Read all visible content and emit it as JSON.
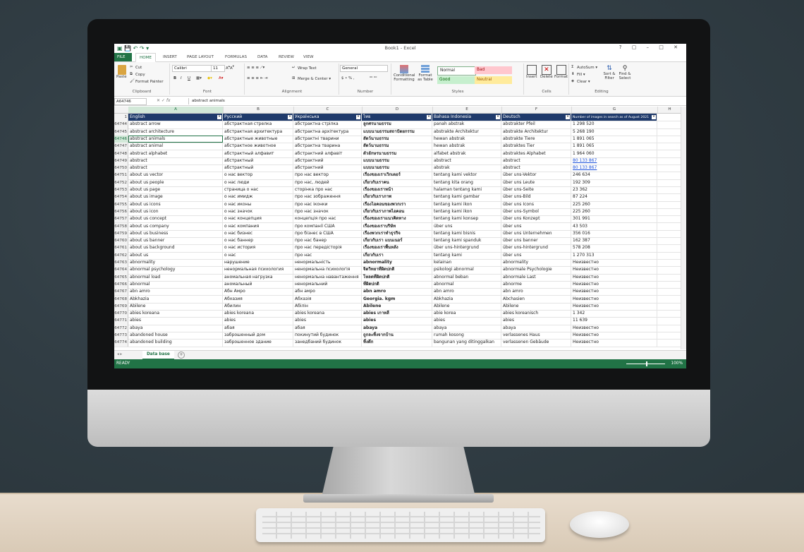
{
  "window": {
    "title": "Book1 - Excel",
    "controls": "? ▢ – □ ✕"
  },
  "ribbon_tabs": [
    "FILE",
    "HOME",
    "INSERT",
    "PAGE LAYOUT",
    "FORMULAS",
    "DATA",
    "REVIEW",
    "VIEW"
  ],
  "active_tab": "HOME",
  "ribbon": {
    "clipboard": {
      "label": "Clipboard",
      "paste": "Paste",
      "cut": "Cut",
      "copy": "Copy",
      "painter": "Format Painter"
    },
    "font": {
      "label": "Font",
      "name": "Calibri",
      "size": "11"
    },
    "alignment": {
      "label": "Alignment",
      "wrap": "Wrap Text",
      "merge": "Merge & Center"
    },
    "number": {
      "label": "Number",
      "format": "General",
      "symbols": "$ • % ,",
      "decimals": "⁰⁰ ⁰⁰"
    },
    "styles": {
      "label": "Styles",
      "conditional": "Conditional Formatting",
      "format_table": "Format as Table",
      "normal": "Normal",
      "bad": "Bad",
      "good": "Good",
      "neutral": "Neutral"
    },
    "cells": {
      "label": "Cells",
      "insert": "Insert",
      "delete": "Delete",
      "format": "Format"
    },
    "editing": {
      "label": "Editing",
      "autosum": "AutoSum",
      "fill": "Fill",
      "clear": "Clear",
      "sort": "Sort & Filter",
      "find": "Find & Select"
    }
  },
  "formula_bar": {
    "name_box": "A64746",
    "fx": "fx",
    "value": "abstract animals"
  },
  "columns": [
    "A",
    "B",
    "C",
    "D",
    "E",
    "F",
    "G",
    "H"
  ],
  "header_row": {
    "row": "1",
    "cells": [
      "English",
      "Русский",
      "Українська",
      "ไทย",
      "Bahasa Indonesia",
      "Deutsch",
      "Number of images in search as of August 2021"
    ]
  },
  "rows": [
    {
      "n": "64744",
      "c": [
        "abstract arrow",
        "абстрактная стрелка",
        "абстрактна стрілка",
        "ลูกศรนามธรรม",
        "panah abstrak",
        "abstrakter Pfeil",
        "1 298 520"
      ]
    },
    {
      "n": "64745",
      "c": [
        "abstract architecture",
        "абстрактная архитектура",
        "абстрактна архітектура",
        "แบบนามธรรมสถาปัตยกรรม",
        "abstrakte Architektur",
        "abstrakte Architektur",
        "5 268 190"
      ]
    },
    {
      "n": "64746",
      "c": [
        "abstract animals",
        "абстрактные животные",
        "абстрактні тварини",
        "สัตว์นามธรรม",
        "hewan abstrak",
        "abstrakte Tiere",
        "1 891 065"
      ]
    },
    {
      "n": "64747",
      "c": [
        "abstract animal",
        "абстрактное животное",
        "абстрактна тварина",
        "สัตว์นามธรรม",
        "hewan abstrak",
        "abstraktes Tier",
        "1 891 065"
      ]
    },
    {
      "n": "64748",
      "c": [
        "abstract alphabet",
        "абстрактный алфавит",
        "абстрактний алфавіт",
        "ตัวอักษรนามธรรม",
        "alfabet abstrak",
        "abstraktes Alphabet",
        "1 964 060"
      ]
    },
    {
      "n": "64749",
      "c": [
        "abstract",
        "абстрактный",
        "абстрактний",
        "แบบนามธรรม",
        "abstract",
        "abstract",
        "80 133 867"
      ]
    },
    {
      "n": "64750",
      "c": [
        "abstract",
        "абстрактный",
        "абстрактний",
        "แบบนามธรรม",
        "abstrak",
        "abstract",
        "80 133 867"
      ]
    },
    {
      "n": "64751",
      "c": [
        "about us vector",
        "о нас вектор",
        "про нас вектор",
        "เรื่องของเราเวิกเตอร์",
        "tentang kami vektor",
        "über uns-Vektor",
        "246 634"
      ]
    },
    {
      "n": "64752",
      "c": [
        "about us people",
        "о нас люди",
        "про нас, людей",
        "เกี่ยวกับเราคน",
        "tentang kita orang",
        "über uns Leute",
        "192 309"
      ]
    },
    {
      "n": "64753",
      "c": [
        "about us page",
        "страница о нас",
        "сторінка про нас",
        "เรื่องของเราหน้า",
        "halaman tentang kami",
        "über uns-Seite",
        "23 362"
      ]
    },
    {
      "n": "64754",
      "c": [
        "about us image",
        "о нас имидж",
        "про нас зображення",
        "เกี่ยวกับเราภาพ",
        "tentang kami gambar",
        "über uns-Bild",
        "87 224"
      ]
    },
    {
      "n": "64755",
      "c": [
        "about us icons",
        "о нас иконы",
        "про нас іконки",
        "เรื่องไอคอนของพวกเรา",
        "tentang kami ikon",
        "über uns Icons",
        "225 260"
      ]
    },
    {
      "n": "64756",
      "c": [
        "about us icon",
        "о нас значок",
        "про нас значок",
        "เกี่ยวกับเราภาพไอคอน",
        "tentang kami ikon",
        "über uns-Symbol",
        "225 260"
      ]
    },
    {
      "n": "64757",
      "c": [
        "about us concept",
        "о нас концепция",
        "концепція про нас",
        "เรื่องของเราแนวคิดทาง",
        "tentang kami konsep",
        "über uns Konzept",
        "301 991"
      ]
    },
    {
      "n": "64758",
      "c": [
        "about us company",
        "о нас компания",
        "про компанії США",
        "เรื่องของเราบริษัท",
        "über uns",
        "über uns",
        "43 503"
      ]
    },
    {
      "n": "64759",
      "c": [
        "about us business",
        "о нас бизнес",
        "про бізнес в США",
        "เรื่องพวกเราทำธุรกิจ",
        "tentang kami bisnis",
        "über uns Unternehmen",
        "356 016"
      ]
    },
    {
      "n": "64760",
      "c": [
        "about us banner",
        "о нас баннер",
        "про нас банер",
        "เกี่ยวกับเรา แบนเนอร์",
        "tentang kami spanduk",
        "über uns banner",
        "162 387"
      ]
    },
    {
      "n": "64761",
      "c": [
        "about us background",
        "о нас история",
        "про нас передісторія",
        "เรื่องของเราพื้นหลัง",
        "über uns-hintergrund",
        "über uns-hintergrund",
        "578 208"
      ]
    },
    {
      "n": "64762",
      "c": [
        "about us",
        "о нас",
        "про нас",
        "เกี่ยวกับเรา",
        "tentang kami",
        "über uns",
        "1 270 313"
      ]
    },
    {
      "n": "64763",
      "c": [
        "abnormality",
        "нарушение",
        "ненормальність",
        "abnormality",
        "kelainan",
        "abnormality",
        "Неизвестно"
      ]
    },
    {
      "n": "64764",
      "c": [
        "abnormal psychology",
        "ненормальная психология",
        "ненормальна психологія",
        "จิตวิทยาที่ผิดปกติ",
        "psikologi abnormal",
        "abnormale Psychologie",
        "Неизвестно"
      ]
    },
    {
      "n": "64765",
      "c": [
        "abnormal load",
        "аномальная нагрузка",
        "ненормальна навантаження",
        "โหลดที่ผิดปกติ",
        "abnormal beban",
        "abnormale Last",
        "Неизвестно"
      ]
    },
    {
      "n": "64766",
      "c": [
        "abnormal",
        "аномальный",
        "ненормальний",
        "ที่ผิดปกติ",
        "abnormal",
        "abnorme",
        "Неизвестно"
      ]
    },
    {
      "n": "64767",
      "c": [
        "abn amro",
        "Абн Амро",
        "абн амро",
        "abn amro",
        "abn amro",
        "abn amro",
        "Неизвестно"
      ]
    },
    {
      "n": "64768",
      "c": [
        "Abkhazia",
        "Абхазия",
        "Абхазія",
        "Georgia. kgm",
        "Abkhazia",
        "Abchasien",
        "Неизвестно"
      ]
    },
    {
      "n": "64769",
      "c": [
        "Abilene",
        "Абилин",
        "Абілін",
        "Abilene",
        "Abilene",
        "Abilene",
        "Неизвестно"
      ]
    },
    {
      "n": "64770",
      "c": [
        "abies koreana",
        "abies koreana",
        "abies koreana",
        "abies เกาหลี",
        "abie korea",
        "abies koreanisch",
        "1 342"
      ]
    },
    {
      "n": "64771",
      "c": [
        "abies",
        "abies",
        "abies",
        "abies",
        "abies",
        "abies",
        "11 639"
      ]
    },
    {
      "n": "64772",
      "c": [
        "abaya",
        "абая",
        "абая",
        "abaya",
        "abaya",
        "abaya",
        "Неизвестно"
      ]
    },
    {
      "n": "64773",
      "c": [
        "abandoned house",
        "заброшенный дом",
        "покинутий будинок",
        "ถูกละทิ้งจากบ้าน",
        "rumah kosong",
        "verlassenes Haus",
        "Неизвестно"
      ]
    },
    {
      "n": "64774",
      "c": [
        "abandoned building",
        "заброшенное здание",
        "занедбаний будинок",
        "ทิ้งตึก",
        "bangunan yang ditinggalkan",
        "verlassenen Gebäude",
        "Неизвестно"
      ]
    }
  ],
  "sheet_tab": "Data base",
  "status": {
    "ready": "READY",
    "zoom": "100%"
  }
}
